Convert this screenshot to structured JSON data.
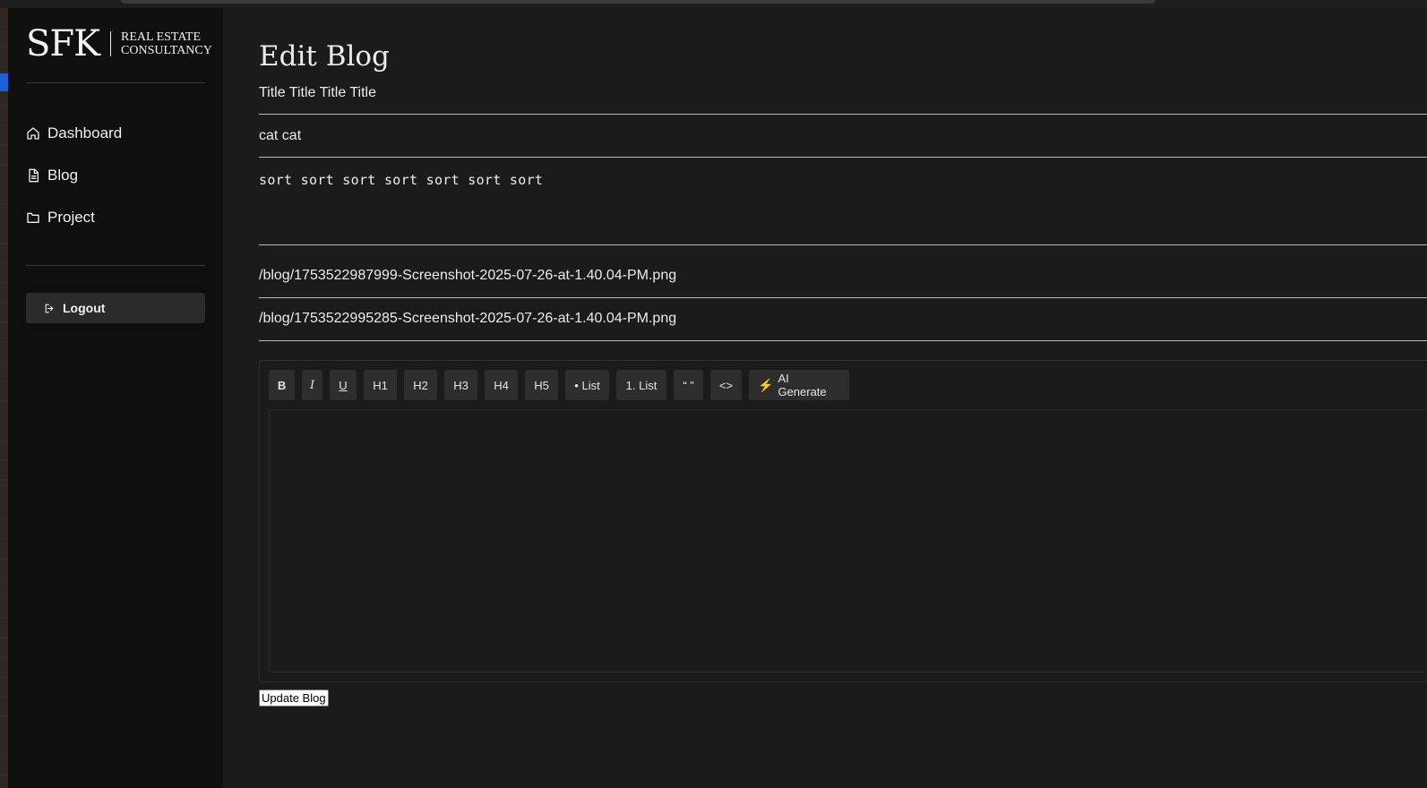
{
  "brand": {
    "mark": "SFK",
    "line1": "REAL ESTATE",
    "line2": "CONSULTANCY"
  },
  "sidebar": {
    "items": [
      {
        "label": "Dashboard",
        "icon": "home-icon"
      },
      {
        "label": "Blog",
        "icon": "document-icon"
      },
      {
        "label": "Project",
        "icon": "folder-icon"
      }
    ],
    "logout_label": "Logout"
  },
  "page": {
    "title": "Edit Blog"
  },
  "form": {
    "title_value": "Title Title Title Title",
    "category_value": "cat cat",
    "short_value": "sort sort sort sort sort sort sort",
    "image1_value": "/blog/1753522987999-Screenshot-2025-07-26-at-1.40.04-PM.png",
    "image2_value": "/blog/1753522995285-Screenshot-2025-07-26-at-1.40.04-PM.png",
    "submit_label": "Update Blog"
  },
  "toolbar": {
    "bold": "B",
    "italic": "I",
    "underline": "U",
    "h1": "H1",
    "h2": "H2",
    "h3": "H3",
    "h4": "H4",
    "h5": "H5",
    "bullet_list": "• List",
    "numbered_list": "1. List",
    "quote": "“ ”",
    "code": "<>",
    "ai_generate": "AI Generate"
  },
  "colors": {
    "sidebar_bg": "#0f0f0f",
    "main_bg": "#1b1b1b",
    "ai_bolt": "#f5c518"
  }
}
